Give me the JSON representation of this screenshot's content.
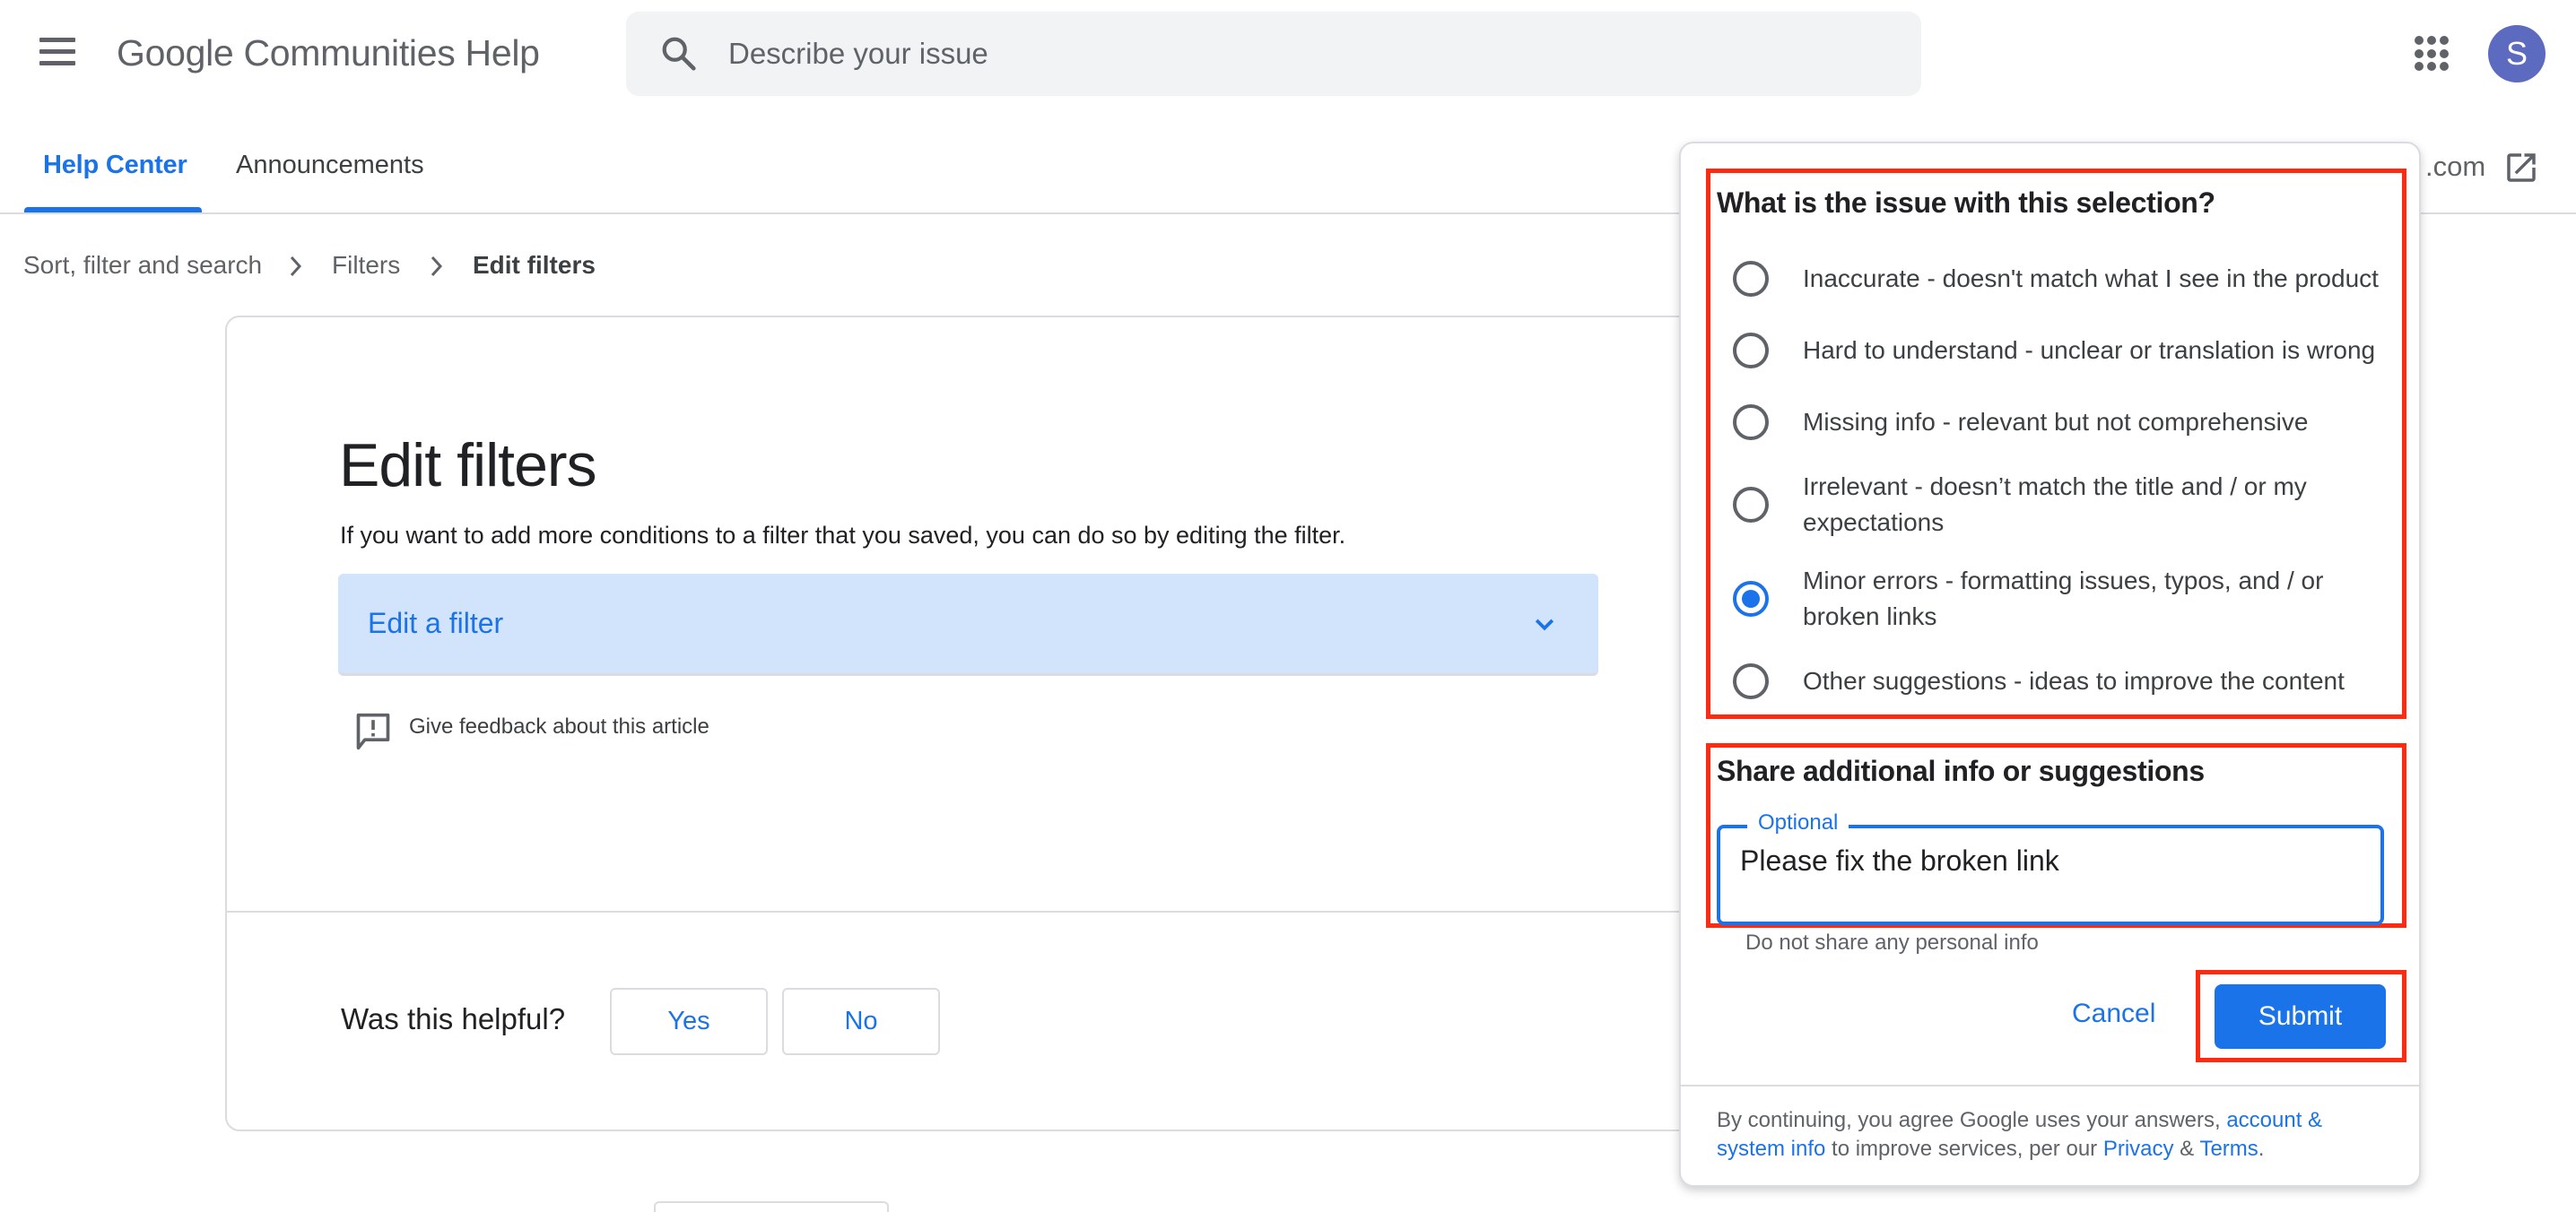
{
  "header": {
    "app_title": "Google Communities Help",
    "search_placeholder": "Describe your issue",
    "avatar_letter": "S",
    "icons": {
      "menu": "hamburger-icon",
      "search": "search-icon",
      "apps": "apps-grid-icon",
      "external": "open-in-new-icon"
    }
  },
  "tabs": [
    {
      "label": "Help Center",
      "active": true
    },
    {
      "label": "Announcements",
      "active": false
    }
  ],
  "external_link": {
    "label": ".com"
  },
  "breadcrumb": [
    {
      "label": "Sort, filter and search"
    },
    {
      "label": "Filters"
    },
    {
      "label": "Edit filters",
      "current": true
    }
  ],
  "article": {
    "title": "Edit filters",
    "body": "If you want to add more conditions to a filter that you saved, you can do so by editing the filter.",
    "accordion_label": "Edit a filter",
    "feedback_link": "Give feedback about this article",
    "helpful": {
      "question": "Was this helpful?",
      "yes": "Yes",
      "no": "No"
    }
  },
  "feedback_panel": {
    "question": "What is the issue with this selection?",
    "options": [
      {
        "label": "Inaccurate - doesn't match what I see in the product",
        "checked": false
      },
      {
        "label": "Hard to understand - unclear or translation is wrong",
        "checked": false
      },
      {
        "label": "Missing info - relevant but not comprehensive",
        "checked": false
      },
      {
        "label": "Irrelevant - doesn’t match the title and / or my expectations",
        "checked": false
      },
      {
        "label": "Minor errors - formatting issues, typos, and / or broken links",
        "checked": true
      },
      {
        "label": "Other suggestions - ideas to improve the content",
        "checked": false
      }
    ],
    "share_title": "Share additional info or suggestions",
    "textarea_label": "Optional",
    "textarea_value": "Please fix the broken link",
    "helper_text": "Do not share any personal info",
    "cancel_label": "Cancel",
    "submit_label": "Submit",
    "legal": {
      "prefix": "By continuing, you agree Google uses your answers, ",
      "link1": "account & system info",
      "middle": " to improve services, per our ",
      "link2": "Privacy",
      "amp": " & ",
      "link3": "Terms",
      "suffix": "."
    }
  },
  "colors": {
    "accent": "#1a73e8",
    "annotation_red": "#ff2a0f",
    "avatar": "#5c6bc0",
    "accordion_bg": "#d2e3fc"
  }
}
